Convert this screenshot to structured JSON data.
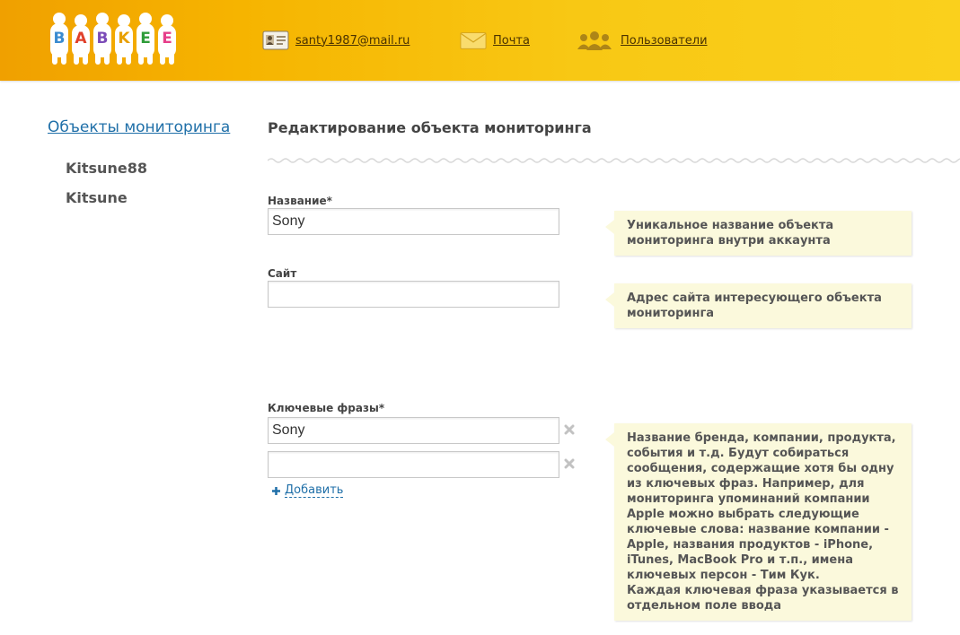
{
  "header": {
    "logo_text": "BABKEE",
    "logo_letters": [
      "B",
      "A",
      "B",
      "K",
      "E",
      "E"
    ],
    "logo_letter_colors": [
      "#3a8bd0",
      "#e0402a",
      "#7b4bb8",
      "#e8a000",
      "#2f9c3a",
      "#e63e8a"
    ],
    "nav": [
      {
        "icon": "profile-card-icon",
        "label": "santy1987@mail.ru"
      },
      {
        "icon": "mail-envelope-icon",
        "label": "Почта"
      },
      {
        "icon": "users-icon",
        "label": "Пользователи"
      }
    ]
  },
  "sidebar": {
    "title": "Объекты мониторинга",
    "items": [
      {
        "label": "Kitsune88"
      },
      {
        "label": "Kitsune"
      }
    ]
  },
  "main": {
    "title": "Редактирование объекта мониторинга",
    "fields": {
      "name": {
        "label": "Название*",
        "value": "Sony"
      },
      "site": {
        "label": "Сайт",
        "value": ""
      },
      "keywords": {
        "label": "Ключевые фразы*",
        "values": [
          "Sony",
          ""
        ]
      }
    },
    "add_label": "Добавить",
    "hints": {
      "name": "Уникальное название объекта мониторинга внутри аккаунта",
      "site": "Адрес сайта интересующего объекта мониторинга",
      "keywords": "Название бренда, компании, продукта, события и т.д. Будут собираться сообщения, содержащие хотя бы одну из ключевых фраз. Например, для мониторинга упоминаний компании Apple можно выбрать следующие ключевые слова: название компании - Apple, названия продуктов - iPhone, iTunes, MacBook Pro и т.п., имена ключевых персон - Тим Кук.\nКаждая ключевая фраза указывается в отдельном поле ввода"
    }
  },
  "colors": {
    "header_gradient_start": "#f0a000",
    "header_gradient_end": "#fad01c",
    "link_blue": "#1f6fa8",
    "hint_bg": "#fbf9dc"
  }
}
